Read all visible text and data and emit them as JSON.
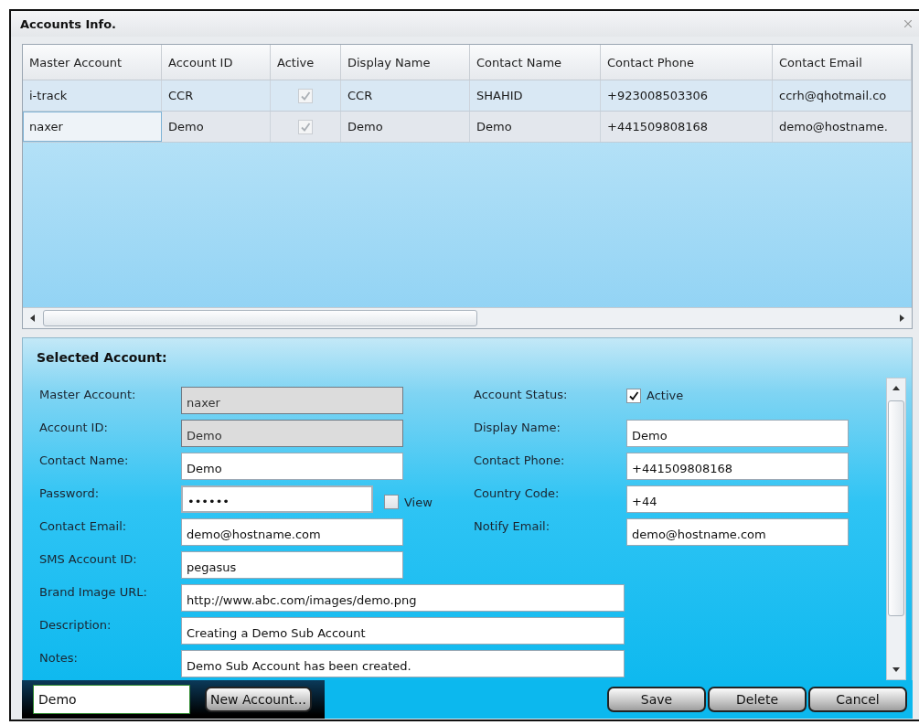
{
  "window": {
    "title": "Accounts Info."
  },
  "grid": {
    "columns": [
      "Master Account",
      "Account ID",
      "Active",
      "Display Name",
      "Contact Name",
      "Contact Phone",
      "Contact Email"
    ],
    "rows": [
      {
        "master": "i-track",
        "id": "CCR",
        "active": true,
        "display": "CCR",
        "contact": "SHAHID",
        "phone": "+923008503306",
        "email": "ccrh@qhotmail.co",
        "selected": false
      },
      {
        "master": "naxer",
        "id": "Demo",
        "active": true,
        "display": "Demo",
        "contact": "Demo",
        "phone": "+441509808168",
        "email": "demo@hostname.",
        "selected": true
      }
    ]
  },
  "form": {
    "title": "Selected Account:",
    "rows": [
      {
        "left": {
          "kind": "field",
          "label": "Master Account:",
          "value": "naxer",
          "readonly": true
        },
        "right": {
          "kind": "checkbox",
          "label": "Account Status:",
          "text": "Active",
          "checked": true
        }
      },
      {
        "left": {
          "kind": "field",
          "label": "Account ID:",
          "value": "Demo",
          "readonly": true
        },
        "right": {
          "kind": "field",
          "label": "Display Name:",
          "value": "Demo",
          "readonly": false
        }
      },
      {
        "left": {
          "kind": "field",
          "label": "Contact Name:",
          "value": "Demo",
          "readonly": false
        },
        "right": {
          "kind": "field",
          "label": "Contact Phone:",
          "value": "+441509808168",
          "readonly": false
        }
      },
      {
        "left": {
          "kind": "password",
          "label": "Password:",
          "value": "••••••",
          "readonly": false,
          "reveal": {
            "text": "View",
            "checked": false
          }
        },
        "right": {
          "kind": "field",
          "label": "Country Code:",
          "value": "+44",
          "readonly": false
        }
      },
      {
        "left": {
          "kind": "field",
          "label": "Contact Email:",
          "value": "demo@hostname.com",
          "readonly": false
        },
        "right": {
          "kind": "field",
          "label": "Notify Email:",
          "value": "demo@hostname.com",
          "readonly": false
        }
      },
      {
        "left": {
          "kind": "field",
          "label": "SMS Account ID:",
          "value": "pegasus",
          "readonly": false
        }
      },
      {
        "left": {
          "kind": "wide",
          "label": "Brand Image URL:",
          "value": "http://www.abc.com/images/demo.png",
          "readonly": false
        }
      },
      {
        "left": {
          "kind": "wide",
          "label": "Description:",
          "value": "Creating a Demo Sub Account",
          "readonly": false
        }
      },
      {
        "left": {
          "kind": "wide",
          "label": "Notes:",
          "value": "Demo Sub Account has been created.",
          "readonly": false
        }
      }
    ]
  },
  "footer": {
    "search_value": "Demo",
    "new_button": "New Account...",
    "buttons": [
      "Save",
      "Delete",
      "Cancel"
    ]
  }
}
